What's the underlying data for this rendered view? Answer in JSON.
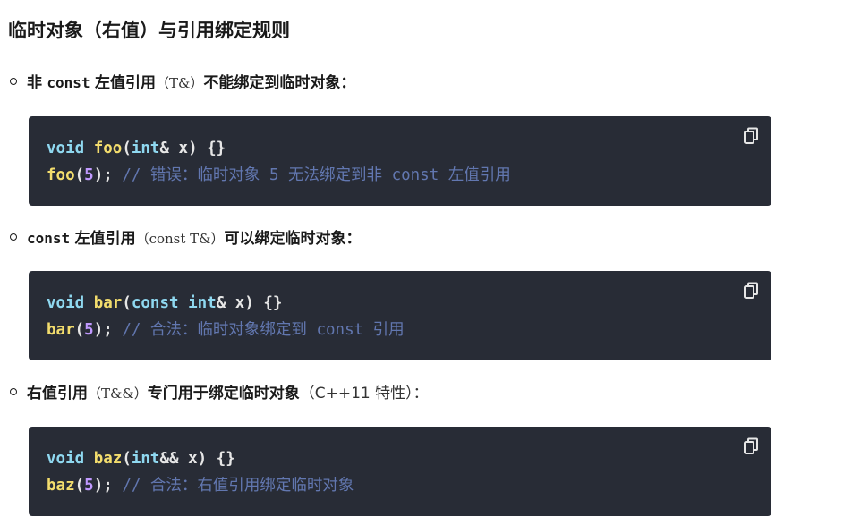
{
  "title": "临时对象（右值）与引用绑定规则",
  "items": [
    {
      "text_a": "非",
      "code_a": "const",
      "text_b": "左值引用",
      "paren": "（T&）",
      "text_c": "不能绑定到临时对象：",
      "code": {
        "line1": {
          "kw": "void",
          "fn": "foo",
          "open": "(",
          "type": "int",
          "rest": "& x) {}"
        },
        "line2": {
          "fn": "foo",
          "open": "(",
          "num": "5",
          "close": ");",
          "comment": " // 错误：临时对象 5 无法绑定到非 const 左值引用"
        }
      }
    },
    {
      "code_a": "const",
      "text_b": "左值引用",
      "paren": "（const T&）",
      "text_c": "可以绑定临时对象：",
      "code": {
        "line1": {
          "kw": "void",
          "fn": "bar",
          "open": "(",
          "kw2": "const",
          "type": "int",
          "rest": "& x) {}"
        },
        "line2": {
          "fn": "bar",
          "open": "(",
          "num": "5",
          "close": ");",
          "comment": " // 合法：临时对象绑定到 const 引用"
        }
      }
    },
    {
      "text_b": "右值引用",
      "paren": "（T&&）",
      "text_c": "专门用于绑定临时对象",
      "tail": "（C++11 特性）：",
      "code": {
        "line1": {
          "kw": "void",
          "fn": "baz",
          "open": "(",
          "type": "int",
          "rest": "&& x) {}"
        },
        "line2": {
          "fn": "baz",
          "open": "(",
          "num": "5",
          "close": ");",
          "comment": " // 合法：右值引用绑定临时对象"
        }
      }
    }
  ],
  "icons": {
    "copy": "copy-icon"
  }
}
